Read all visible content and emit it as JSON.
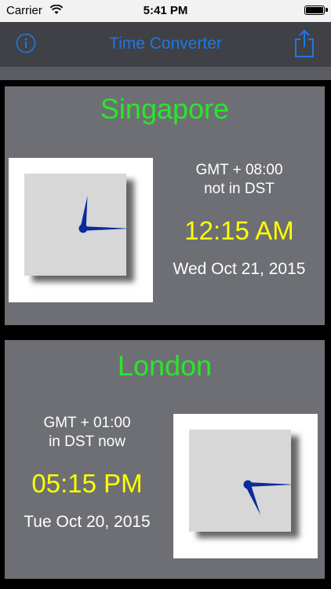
{
  "status": {
    "carrier": "Carrier",
    "time": "5:41 PM"
  },
  "nav": {
    "title": "Time Converter"
  },
  "icons": {
    "info": "info-icon",
    "share": "share-icon",
    "wifi": "wifi-icon",
    "battery": "battery-icon"
  },
  "colors": {
    "accent": "#1e78e6",
    "city": "#2ae62a",
    "time": "#ffff00",
    "hands": "#0b2a9c"
  },
  "cities": [
    {
      "name": "Singapore",
      "gmt": "GMT + 08:00",
      "dst": "not in DST",
      "time": "12:15 AM",
      "date": "Wed Oct 21, 2015",
      "hour": 0,
      "minute": 15
    },
    {
      "name": "London",
      "gmt": "GMT + 01:00",
      "dst": "in DST now",
      "time": "05:15 PM",
      "date": "Tue Oct 20, 2015",
      "hour": 17,
      "minute": 15
    }
  ]
}
